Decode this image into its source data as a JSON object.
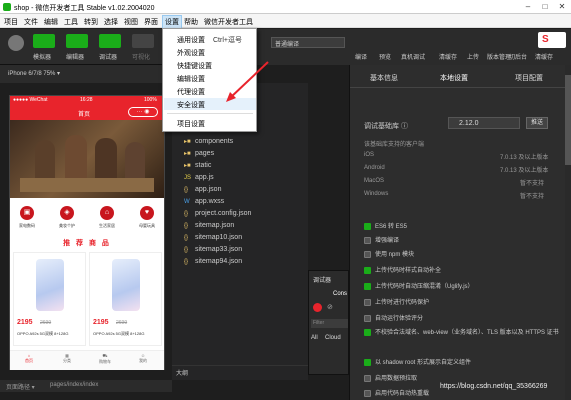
{
  "window": {
    "title": "shop - 微信开发者工具 Stable v1.02.2004020"
  },
  "menubar": {
    "items": [
      "项目",
      "文件",
      "编辑",
      "工具",
      "转到",
      "选择",
      "视图",
      "界面",
      "设置",
      "帮助",
      "微信开发者工具"
    ]
  },
  "toolbar": {
    "left_buttons": [
      "模拟器",
      "编辑器",
      "调试器",
      "可视化"
    ],
    "compile_select": "普通编译",
    "right_buttons": [
      "编译",
      "预览",
      "真机调试",
      "清缓存",
      "上传",
      "版本管理",
      "切后台",
      "清缓存"
    ]
  },
  "settings_menu": {
    "items": [
      {
        "label": "通用设置",
        "shortcut": "Ctrl+逗号"
      },
      {
        "label": "外观设置",
        "shortcut": ""
      },
      {
        "label": "快捷键设置",
        "shortcut": ""
      },
      {
        "label": "编辑设置",
        "shortcut": ""
      },
      {
        "label": "代理设置",
        "shortcut": ""
      },
      {
        "label": "安全设置",
        "shortcut": ""
      },
      {
        "label": "项目设置",
        "shortcut": ""
      }
    ]
  },
  "simulator": {
    "device": "iPhone 6/7/8 75% ▾",
    "status_time": "16:28",
    "status_left": "●●●●● WeChat",
    "status_right": "100%",
    "nav_title": "首页",
    "categories": [
      "家电数码",
      "美妆个护",
      "生活家居",
      "母婴玩具"
    ],
    "hot_title": "推 荐 商 品",
    "products": [
      {
        "price": "2195",
        "old": "2699",
        "name": "OPPO A92s 5G双模 8+128G"
      },
      {
        "price": "2195",
        "old": "2699",
        "name": "OPPO A92s 5G双模 8+128G"
      }
    ],
    "tabs": [
      "首页",
      "分类",
      "购物车",
      "我的"
    ]
  },
  "pathbar": {
    "label": "页面路径 ▾",
    "path": "pages/index/index"
  },
  "files": [
    {
      "name": "components",
      "type": "folder"
    },
    {
      "name": "pages",
      "type": "folder"
    },
    {
      "name": "static",
      "type": "folder"
    },
    {
      "name": "app.js",
      "type": "js"
    },
    {
      "name": "app.json",
      "type": "json"
    },
    {
      "name": "app.wxss",
      "type": "wxss"
    },
    {
      "name": "project.config.json",
      "type": "json"
    },
    {
      "name": "sitemap.json",
      "type": "json"
    },
    {
      "name": "sitemap10.json",
      "type": "json"
    },
    {
      "name": "sitemap33.json",
      "type": "json"
    },
    {
      "name": "sitemap94.json",
      "type": "json"
    }
  ],
  "outline_label": "大纲",
  "debug": {
    "title": "调试器",
    "tab": "Cons",
    "filter": "Filter",
    "tab2": "All",
    "cloud": "Cloud"
  },
  "details": {
    "tabs": [
      "基本信息",
      "本地设置",
      "项目配置"
    ],
    "lib_label": "调试基础库",
    "lib_version": "2.12.0",
    "lib_button": "推送",
    "support_title": "该基础库支持的客户端",
    "platforms": [
      {
        "name": "iOS",
        "version": "7.0.13 及以上版本"
      },
      {
        "name": "Android",
        "version": "7.0.13 及以上版本"
      },
      {
        "name": "MacOS",
        "version": "暂不支持"
      },
      {
        "name": "Windows",
        "version": "暂不支持"
      }
    ],
    "options": [
      {
        "label": "ES6 转 ES5",
        "checked": true
      },
      {
        "label": "增强编译",
        "checked": false
      },
      {
        "label": "使用 npm 模块",
        "checked": false
      },
      {
        "label": "上传代码时样式自动补全",
        "checked": true
      },
      {
        "label": "上传代码时自动压缩混淆（Uglify.js）",
        "checked": true
      },
      {
        "label": "上传时进行代码保护",
        "checked": false
      },
      {
        "label": "自动运行体验评分",
        "checked": false
      },
      {
        "label": "不校验合法域名、web-view（业务域名）、TLS 版本以及 HTTPS 证书",
        "checked": true
      },
      {
        "label": "以 shadow root 形式展示自定义组件",
        "checked": true
      },
      {
        "label": "启用数据预拉取",
        "checked": false
      },
      {
        "label": "启用代码自动热重载",
        "checked": false
      }
    ]
  },
  "watermark": "https://blog.csdn.net/qq_35366269",
  "colors": {
    "accent": "#1aad19",
    "brand_red": "#e8242c",
    "arrow": "#e8242c"
  }
}
